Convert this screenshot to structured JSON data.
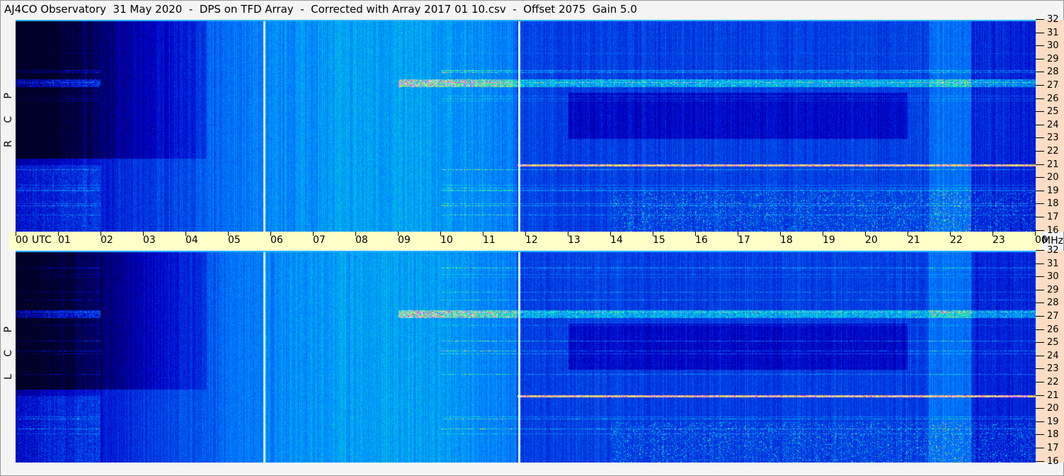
{
  "title": "AJ4CO Observatory  31 May 2020  -  DPS on TFD Array  -  Corrected with Array 2017 01 10.csv  -  Offset 2075  Gain 5.0",
  "panels": [
    {
      "label": "R C P"
    },
    {
      "label": "L C P"
    }
  ],
  "hours": [
    "00",
    "01",
    "02",
    "03",
    "04",
    "05",
    "06",
    "07",
    "08",
    "09",
    "10",
    "11",
    "12",
    "13",
    "14",
    "15",
    "16",
    "17",
    "18",
    "19",
    "20",
    "21",
    "22",
    "23",
    "00"
  ],
  "utc_label": "UTC",
  "mhz_label": "MHz",
  "freq_ticks": [
    "32",
    "31",
    "30",
    "29",
    "28",
    "27",
    "26",
    "25",
    "24",
    "23",
    "22",
    "21",
    "20",
    "19",
    "18",
    "17",
    "16"
  ],
  "colors": {
    "utc_bar": "#ffffc8",
    "freq_axis": "#fcdcc4"
  }
}
